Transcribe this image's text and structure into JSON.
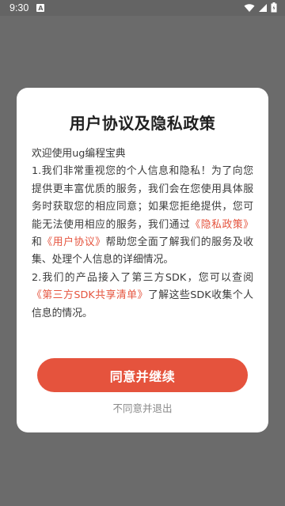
{
  "status_bar": {
    "time": "9:30",
    "notification_letter": "A"
  },
  "dialog": {
    "title": "用户协议及隐私政策",
    "welcome": "欢迎使用ug编程宝典",
    "p1_a": "1.我们非常重视您的个人信息和隐私！为了向您提供更丰富优质的服务，我们会在您使用具体服务时获取您的相应同意；如果您拒绝提供，您可能无法使用相应的服务，我们通过",
    "privacy_link": "《隐私政策》",
    "p1_and": "和",
    "user_agreement_link": "《用户协议》",
    "p1_b": "帮助您全面了解我们的服务及收集、处理个人信息的详细情况。",
    "p2_a": "2.我们的产品接入了第三方SDK，您可以查阅",
    "sdk_list_link": "《第三方SDK共享清单》",
    "p2_b": "了解这些SDK收集个人信息的情况。",
    "agree_label": "同意并继续",
    "disagree_label": "不同意并退出"
  },
  "colors": {
    "accent": "#e5533d",
    "overlay": "#6b6b6b",
    "dialog_bg": "#ffffff"
  }
}
